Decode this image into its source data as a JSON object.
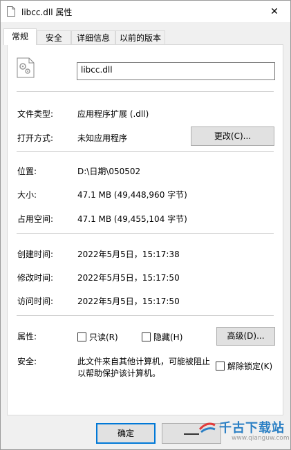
{
  "window": {
    "title": "libcc.dll 属性",
    "close_glyph": "✕"
  },
  "tabs": [
    {
      "label": "常规",
      "active": true
    },
    {
      "label": "安全",
      "active": false
    },
    {
      "label": "详细信息",
      "active": false
    },
    {
      "label": "以前的版本",
      "active": false
    }
  ],
  "general": {
    "file_name": "libcc.dll",
    "file_type_label": "文件类型:",
    "file_type_value": "应用程序扩展 (.dll)",
    "opens_with_label": "打开方式:",
    "opens_with_value": "未知应用程序",
    "change_button": "更改(C)...",
    "location_label": "位置:",
    "location_value": "D:\\日期\\050502",
    "size_label": "大小:",
    "size_value": "47.1 MB (49,448,960 字节)",
    "size_on_disk_label": "占用空间:",
    "size_on_disk_value": "47.1 MB (49,455,104 字节)",
    "created_label": "创建时间:",
    "created_value": "2022年5月5日，15:17:38",
    "modified_label": "修改时间:",
    "modified_value": "2022年5月5日，15:17:50",
    "accessed_label": "访问时间:",
    "accessed_value": "2022年5月5日，15:17:50",
    "attributes_label": "属性:",
    "readonly_label": "只读(R)",
    "readonly_checked": false,
    "hidden_label": "隐藏(H)",
    "hidden_checked": false,
    "advanced_button": "高级(D)...",
    "security_label": "安全:",
    "security_text_line1": "此文件来自其他计算机，可能被阻止",
    "security_text_line2": "以帮助保护该计算机。",
    "unblock_label": "解除锁定(K)",
    "unblock_checked": false
  },
  "footer": {
    "ok_button": "确定"
  },
  "watermark": {
    "brand": "千古下载站",
    "url": "www.qianguw.com"
  },
  "colors": {
    "accent": "#0078d7",
    "watermark_blue": "#2a7fc4"
  }
}
